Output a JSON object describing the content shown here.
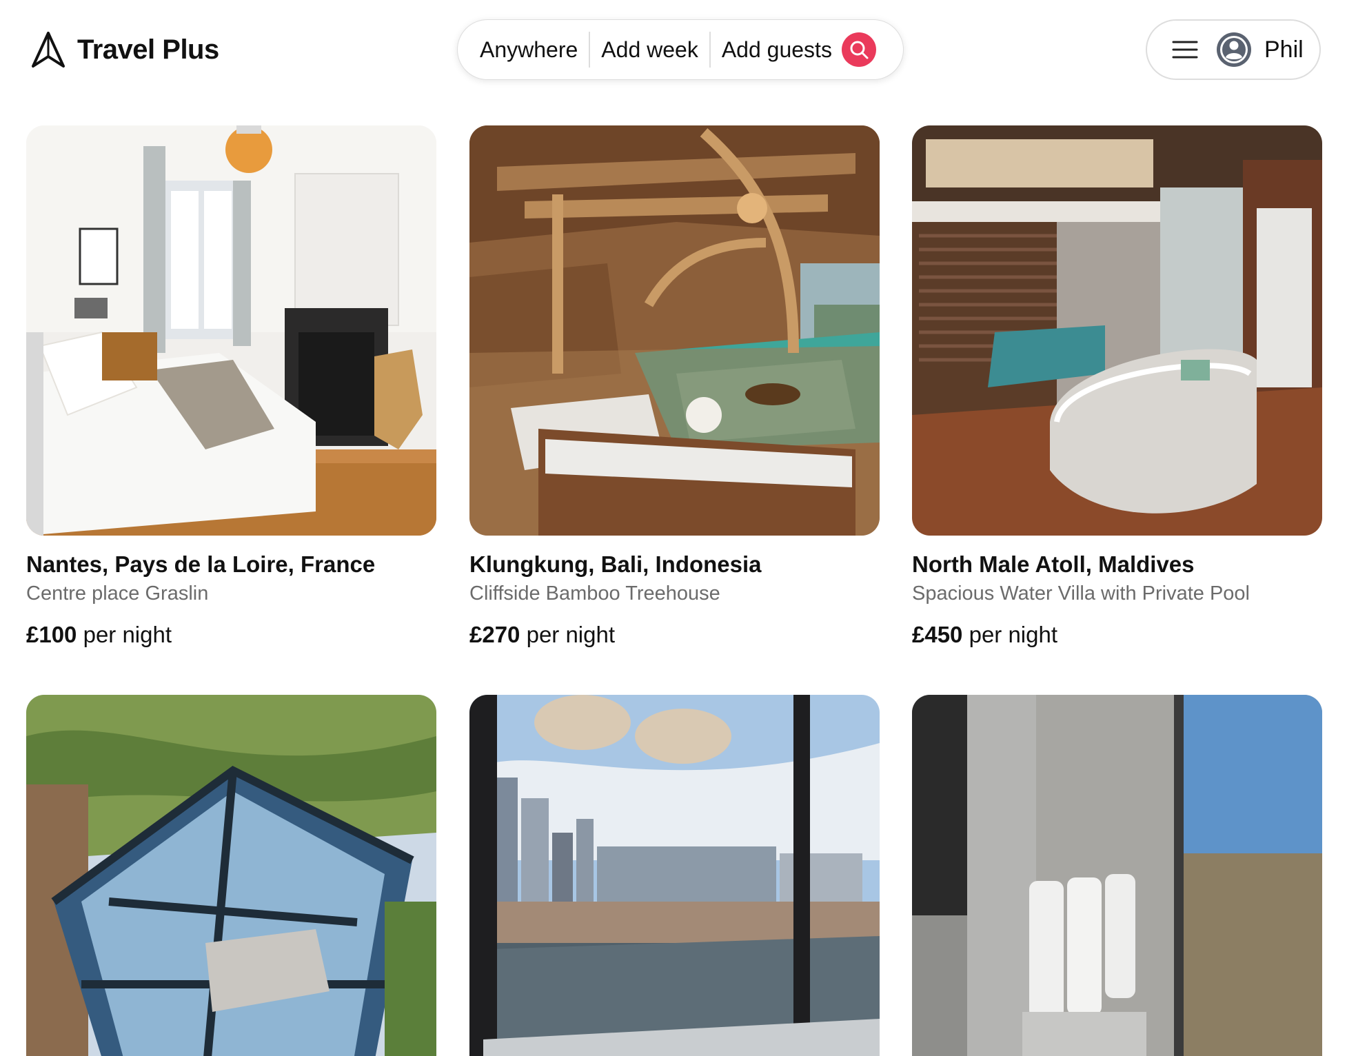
{
  "header": {
    "logo_text": "Travel Plus",
    "search": {
      "anywhere": "Anywhere",
      "week": "Add week",
      "guests": "Add guests"
    },
    "user": {
      "name": "Phil"
    }
  },
  "colors": {
    "accent": "#ea3a5b",
    "text": "#111111",
    "muted": "#6b6b6b",
    "border": "#dddddd"
  },
  "listings": [
    {
      "title": "Nantes, Pays de la Loire, France",
      "subtitle": "Centre place Graslin",
      "price": "£100",
      "per": "per night"
    },
    {
      "title": "Klungkung, Bali, Indonesia",
      "subtitle": "Cliffside Bamboo Treehouse",
      "price": "£270",
      "per": "per night"
    },
    {
      "title": "North Male Atoll, Maldives",
      "subtitle": "Spacious Water Villa with Private Pool",
      "price": "£450",
      "per": "per night"
    }
  ]
}
